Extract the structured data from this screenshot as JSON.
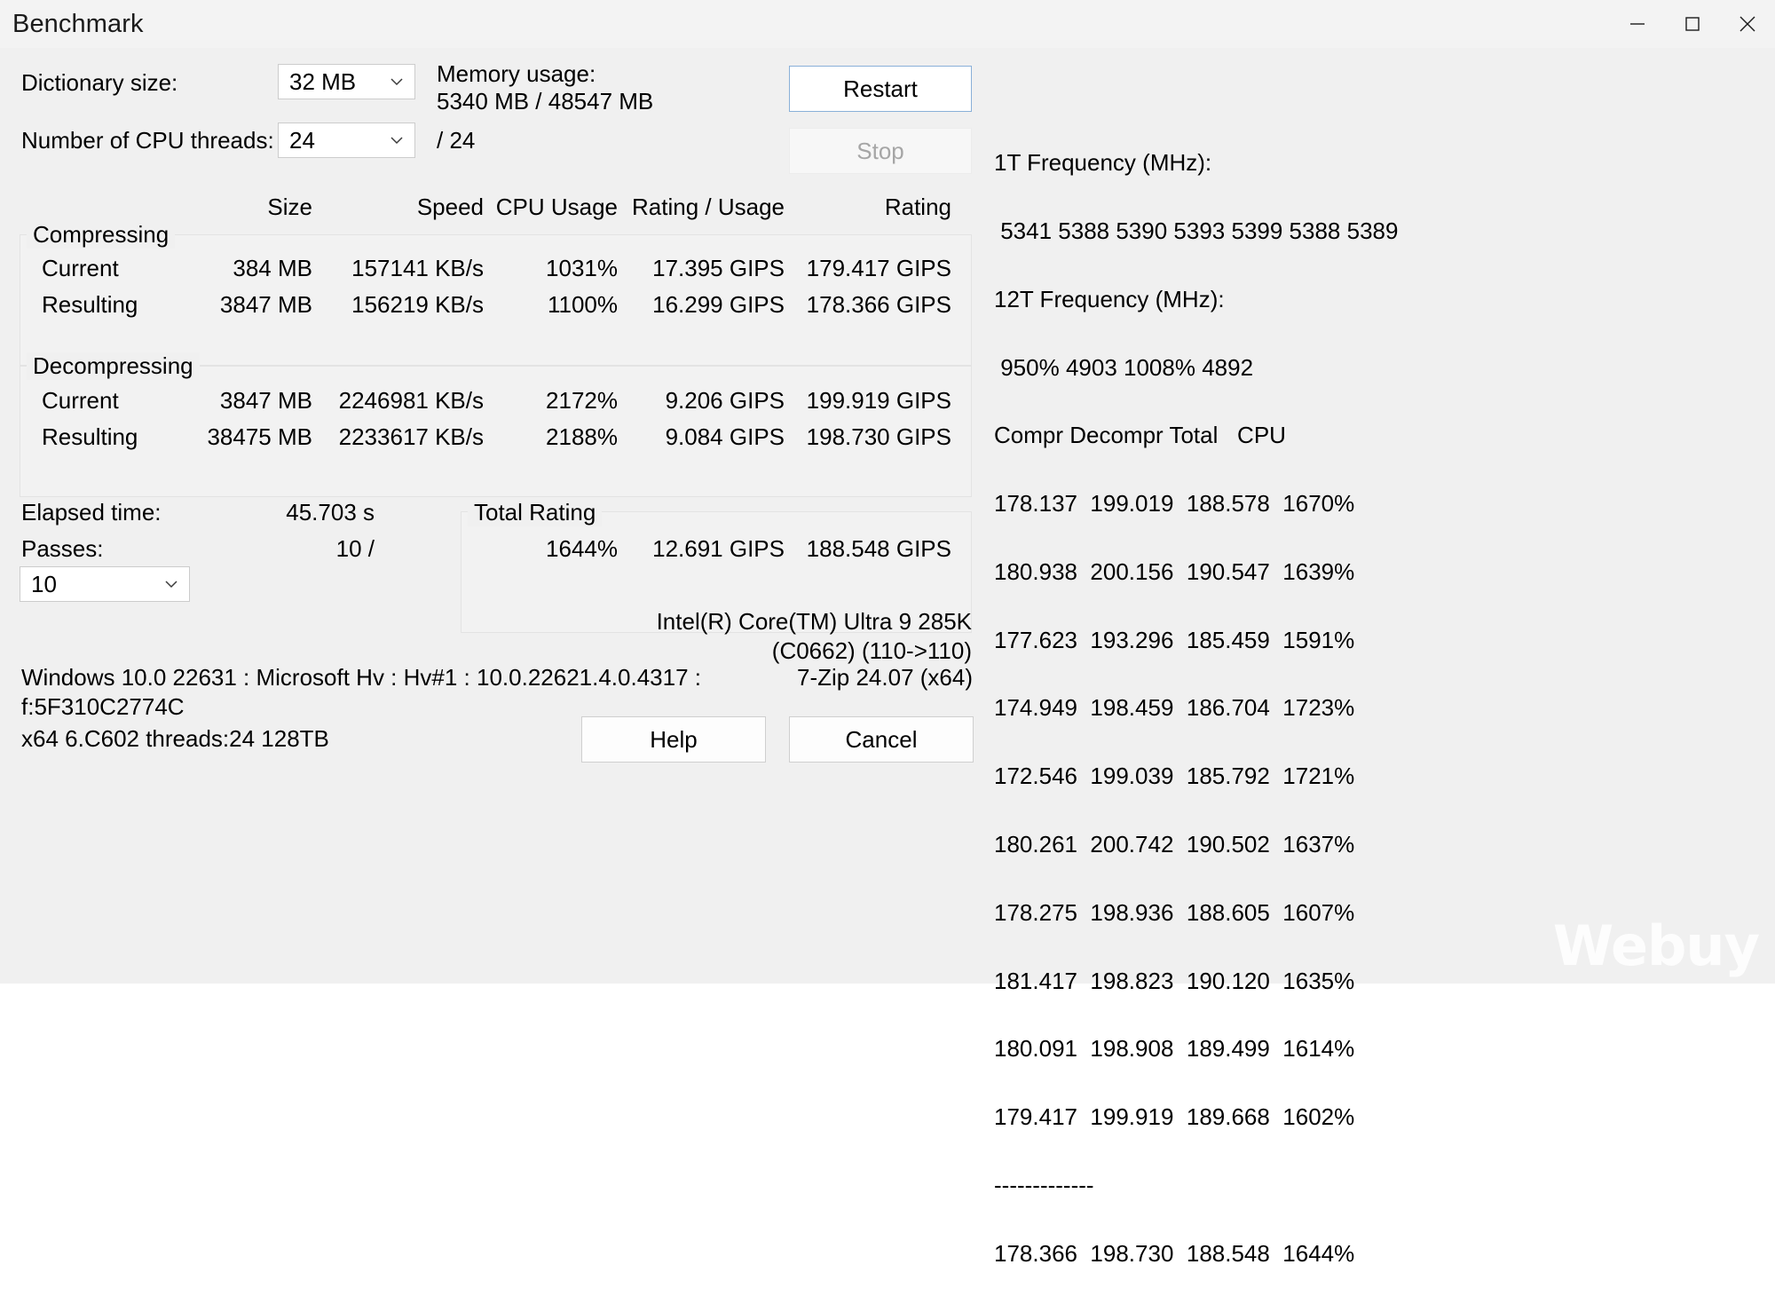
{
  "window": {
    "title": "Benchmark",
    "controls": {
      "minimize": "minimize-icon",
      "maximize": "maximize-icon",
      "close": "close-icon"
    }
  },
  "settings": {
    "dictionary_label": "Dictionary size:",
    "dictionary_value": "32 MB",
    "threads_label": "Number of CPU threads:",
    "threads_value": "24",
    "threads_max": "/ 24",
    "memory_label": "Memory usage:",
    "memory_value": "5340 MB / 48547 MB"
  },
  "buttons": {
    "restart": "Restart",
    "stop": "Stop",
    "help": "Help",
    "cancel": "Cancel"
  },
  "table": {
    "headers": {
      "size": "Size",
      "speed": "Speed",
      "cpu_usage": "CPU Usage",
      "rating_usage": "Rating / Usage",
      "rating": "Rating"
    },
    "compressing": {
      "title": "Compressing",
      "rows": [
        {
          "label": "Current",
          "size": "384 MB",
          "speed": "157141 KB/s",
          "cpu_usage": "1031%",
          "rating_usage": "17.395 GIPS",
          "rating": "179.417 GIPS"
        },
        {
          "label": "Resulting",
          "size": "3847 MB",
          "speed": "156219 KB/s",
          "cpu_usage": "1100%",
          "rating_usage": "16.299 GIPS",
          "rating": "178.366 GIPS"
        }
      ]
    },
    "decompressing": {
      "title": "Decompressing",
      "rows": [
        {
          "label": "Current",
          "size": "3847 MB",
          "speed": "2246981 KB/s",
          "cpu_usage": "2172%",
          "rating_usage": "9.206 GIPS",
          "rating": "199.919 GIPS"
        },
        {
          "label": "Resulting",
          "size": "38475 MB",
          "speed": "2233617 KB/s",
          "cpu_usage": "2188%",
          "rating_usage": "9.084 GIPS",
          "rating": "198.730 GIPS"
        }
      ]
    }
  },
  "footer": {
    "elapsed_label": "Elapsed time:",
    "elapsed_value": "45.703 s",
    "passes_label": "Passes:",
    "passes_value": "10 /",
    "passes_select": "10",
    "total_rating_title": "Total Rating",
    "total_cpu": "1644%",
    "total_rating_usage": "12.691 GIPS",
    "total_rating": "188.548 GIPS",
    "cpu_name": "Intel(R) Core(TM) Ultra 9 285K",
    "cpu_id": "(C0662) (110->110)",
    "system_line1": "Windows 10.0 22631 : Microsoft Hv : Hv#1 : 10.0.22621.4.0.4317 :",
    "system_line2": "f:5F310C2774C",
    "system_line3": "x64 6.C602 threads:24 128TB",
    "version": "7-Zip 24.07 (x64)"
  },
  "results_pane": {
    "freq1t_label": "1T Frequency (MHz):",
    "freq1t_values": " 5341 5388 5390 5393 5399 5388 5389",
    "freq12t_label": "12T Frequency (MHz):",
    "freq12t_values": " 950% 4903 1008% 4892",
    "columns_header": "Compr Decompr Total   CPU",
    "rows": [
      "178.137  199.019  188.578  1670%",
      "180.938  200.156  190.547  1639%",
      "177.623  193.296  185.459  1591%",
      "174.949  198.459  186.704  1723%",
      "172.546  199.039  185.792  1721%",
      "180.261  200.742  190.502  1637%",
      "178.275  198.936  188.605  1607%",
      "181.417  198.823  190.120  1635%",
      "180.091  198.908  189.499  1614%",
      "179.417  199.919  189.668  1602%"
    ],
    "divider": "-------------",
    "total_row": "178.366  198.730  188.548  1644%"
  },
  "watermark": "Webuy"
}
